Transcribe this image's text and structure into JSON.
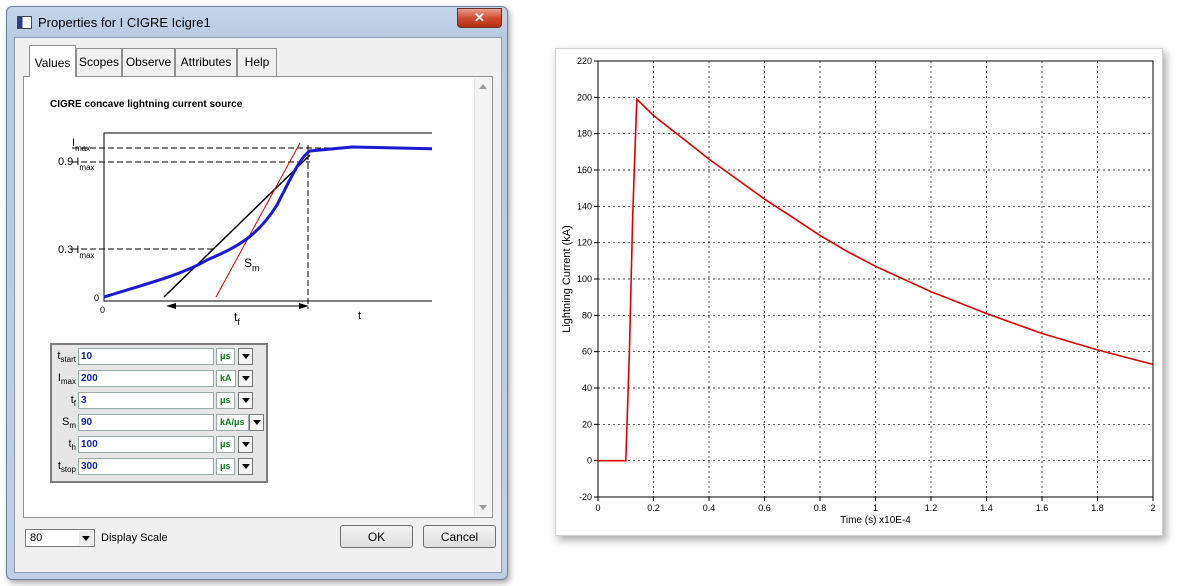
{
  "dialog": {
    "title": "Properties for I CIGRE Icigre1",
    "close_symbol": "✕",
    "tabs": [
      {
        "label": "Values",
        "active": true
      },
      {
        "label": "Scopes",
        "active": false
      },
      {
        "label": "Observe",
        "active": false
      },
      {
        "label": "Attributes",
        "active": false
      },
      {
        "label": "Help",
        "active": false
      }
    ],
    "component_title": "CIGRE concave lightning current source",
    "diagram": {
      "labels": {
        "imax": "I",
        "imax_sub": "max",
        "i09": "0.9 I",
        "i09_sub": "max",
        "i03": "0.3 I",
        "i03_sub": "max",
        "sm": "S",
        "sm_sub": "m",
        "tf": "t",
        "tf_sub": "f",
        "t": "t",
        "zero_x": "0",
        "zero_y": "0"
      }
    },
    "params": [
      {
        "label": "t",
        "sub": "start",
        "value": "10",
        "unit": "μs"
      },
      {
        "label": "I",
        "sub": "max",
        "value": "200",
        "unit": "kA"
      },
      {
        "label": "t",
        "sub": "f",
        "value": "3",
        "unit": "μs"
      },
      {
        "label": "S",
        "sub": "m",
        "value": "90",
        "unit": "kA/μs"
      },
      {
        "label": "t",
        "sub": "h",
        "value": "100",
        "unit": "μs"
      },
      {
        "label": "t",
        "sub": "stop",
        "value": "300",
        "unit": "μs"
      }
    ],
    "display_scale": {
      "value": "80",
      "label": "Display Scale"
    },
    "ok_label": "OK",
    "cancel_label": "Cancel"
  },
  "chart_data": {
    "type": "line",
    "title": "",
    "xlabel": "Time (s) x10E-4",
    "ylabel": "Lightning Current (kA)",
    "xlim": [
      0,
      2
    ],
    "ylim": [
      -20,
      220
    ],
    "xticks": [
      0,
      0.2,
      0.4,
      0.6,
      0.8,
      1,
      1.2,
      1.4,
      1.6,
      1.8,
      2
    ],
    "yticks": [
      -20,
      0,
      20,
      40,
      60,
      80,
      100,
      120,
      140,
      160,
      180,
      200,
      220
    ],
    "grid": true,
    "color": "#e00000",
    "series": [
      {
        "x": [
          0,
          0.1,
          0.113,
          0.125,
          0.14,
          0.2,
          0.3,
          0.4,
          0.5,
          0.6,
          0.7,
          0.8,
          0.9,
          1.0,
          1.2,
          1.4,
          1.6,
          1.8,
          2.0
        ],
        "y": [
          0,
          0,
          60,
          135,
          199,
          190,
          178,
          166,
          155,
          144,
          134,
          124,
          115,
          107,
          93,
          81,
          70,
          61,
          53
        ]
      }
    ]
  },
  "colors": {
    "chart_line": "#e00000",
    "diagram_wave": "#1a1ad6",
    "diagram_tangent": "#000000",
    "diagram_slope": "#e00000",
    "param_value": "#0b1fa8",
    "param_unit": "#0b7a1a"
  }
}
